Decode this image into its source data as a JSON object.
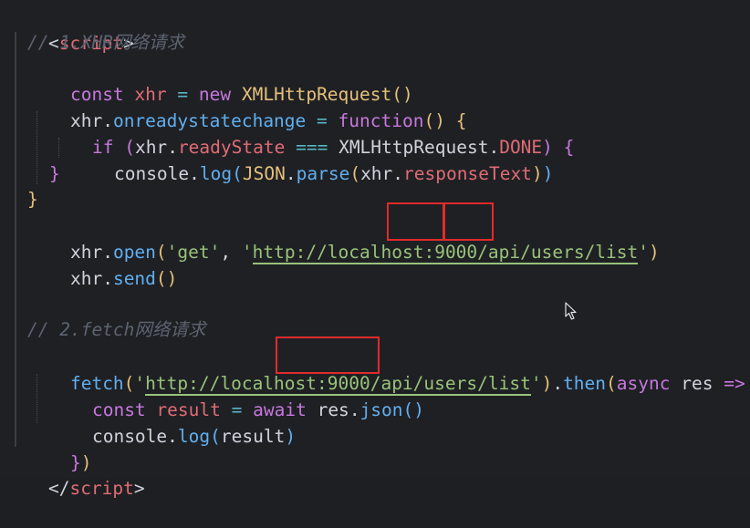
{
  "code": {
    "open_tag": {
      "lt": "<",
      "name": "script",
      "gt": ">"
    },
    "comment1": "// 1.XHR网络请求",
    "l_const": {
      "kw": "const",
      "var": "xhr",
      "eq": "=",
      "new": "new",
      "cls": "XMLHttpRequest",
      "parens": "()"
    },
    "l_onready": {
      "obj": "xhr",
      "dot": ".",
      "prop": "onreadystatechange",
      "eq": "=",
      "kw": "function",
      "parens": "()",
      "brace": "{"
    },
    "l_if": {
      "kw": "if",
      "p1": "(",
      "obj": "xhr",
      "dot": ".",
      "prop": "readyState",
      "op": "===",
      "cls": "XMLHttpRequest",
      "dot2": ".",
      "const": "DONE",
      "p2": ")",
      "brace": "{"
    },
    "l_log": {
      "obj": "console",
      "dot": ".",
      "fn": "log",
      "p1": "(",
      "json": "JSON",
      "dot2": ".",
      "fn2": "parse",
      "p2": "(",
      "arg": "xhr",
      "dot3": ".",
      "prop": "responseText",
      "p3": ")",
      "p4": ")"
    },
    "l_close_if": "}",
    "l_close_fn": "}",
    "l_open": {
      "obj": "xhr",
      "dot": ".",
      "fn": "open",
      "p1": "(",
      "s1": "'get'",
      "comma": ",",
      "q1": "'",
      "url": "http://localhost:9000/api/users/list",
      "q2": "'",
      "p2": ")"
    },
    "l_send": {
      "obj": "xhr",
      "dot": ".",
      "fn": "send",
      "parens": "()"
    },
    "comment2": "// 2.fetch网络请求",
    "l_fetch": {
      "fn": "fetch",
      "p1": "(",
      "q1": "'",
      "url": "http://localhost:9000/api/users/list",
      "q2": "'",
      "p2": ")",
      "dot": ".",
      "then": "then",
      "p3": "(",
      "async": "async",
      "arg": "res",
      "arrow": "=>",
      "brace": "{"
    },
    "l_await": {
      "kw": "const",
      "var": "result",
      "eq": "=",
      "await": "await",
      "obj": "res",
      "dot": ".",
      "fn": "json",
      "parens": "()"
    },
    "l_log2": {
      "obj": "console",
      "dot": ".",
      "fn": "log",
      "p1": "(",
      "arg": "result",
      "p2": ")"
    },
    "l_close_fetch": {
      "brace": "}",
      "paren": ")"
    },
    "close_tag": {
      "lt": "</",
      "name": "script",
      "gt": ">"
    }
  },
  "colors": {
    "background": "#1f2024",
    "highlight_box": "#e02b2b",
    "keyword": "#c678dd",
    "variable": "#e06c75",
    "class": "#e5c07b",
    "function": "#61afef",
    "string": "#98c379",
    "comment": "#5c6370"
  },
  "icons": {
    "cursor": "mouse-pointer-icon"
  }
}
